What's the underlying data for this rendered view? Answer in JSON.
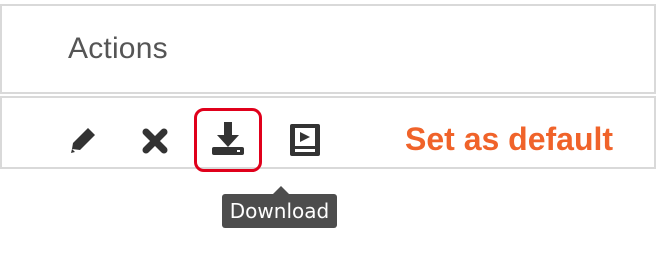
{
  "header": {
    "title": "Actions"
  },
  "actions": {
    "edit_icon": "pencil-icon",
    "delete_icon": "close-icon",
    "download_icon": "download-icon",
    "preview_icon": "preview-icon",
    "set_default_label": "Set as default",
    "set_default_color": "#f0632a"
  },
  "tooltip": {
    "text": "Download"
  },
  "colors": {
    "highlight_border": "#e0001b",
    "icon": "#333333"
  }
}
